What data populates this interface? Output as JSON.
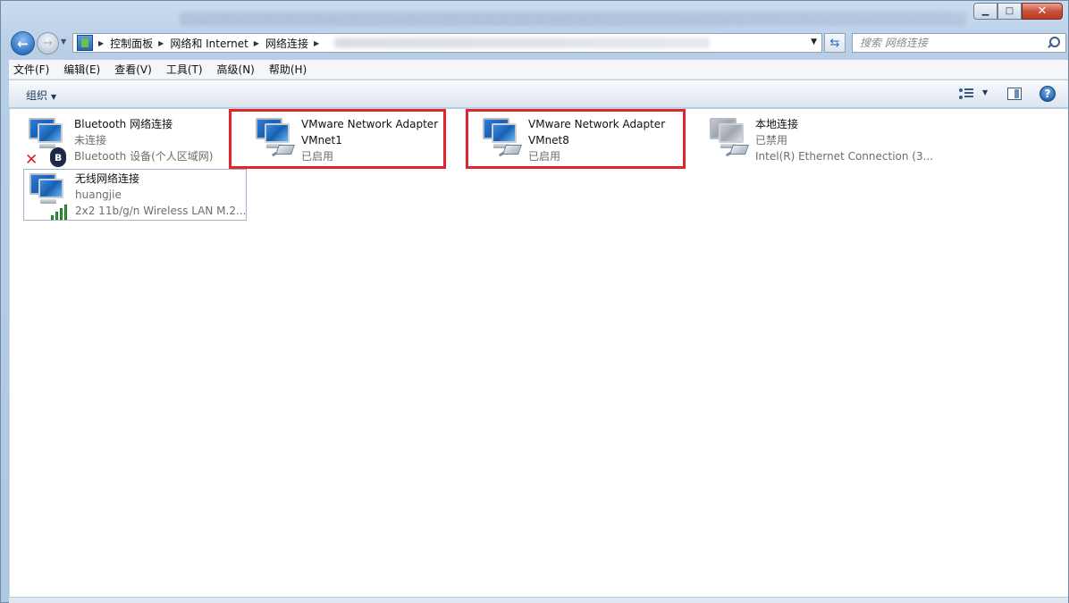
{
  "window": {
    "controls": {
      "minimize": "▁",
      "maximize": "□",
      "close": "✕"
    }
  },
  "nav": {
    "back_icon": "←",
    "forward_icon": "→",
    "history_icon": "▼",
    "breadcrumbs": [
      "控制面板",
      "网络和 Internet",
      "网络连接"
    ],
    "breadcrumb_sep": "▶",
    "address_dropdown": "▼",
    "refresh_icon": "⇆",
    "search_placeholder": "搜索 网络连接"
  },
  "menu": [
    "文件(F)",
    "编辑(E)",
    "查看(V)",
    "工具(T)",
    "高级(N)",
    "帮助(H)"
  ],
  "toolbar": {
    "organize_label": "组织",
    "organize_dropdown": "▼",
    "view_dropdown": "▼",
    "help_label": "?"
  },
  "connections": [
    {
      "name": "Bluetooth 网络连接",
      "line2": "未连接",
      "line3": "Bluetooth 设备(个人区域网)",
      "status_icon": "disconnected-x-icon",
      "type_icon": "bluetooth-icon",
      "bt_glyph": "ʙ",
      "x_glyph": "✕"
    },
    {
      "name": "VMware Network Adapter",
      "line2": "VMnet1",
      "line3": "已启用"
    },
    {
      "name": "VMware Network Adapter",
      "line2": "VMnet8",
      "line3": "已启用"
    },
    {
      "name": "本地连接",
      "line2": "已禁用",
      "line3": "Intel(R) Ethernet Connection (3..."
    },
    {
      "name": "无线网络连接",
      "line2": "huangjie",
      "line3": "2x2 11b/g/n Wireless LAN M.2..."
    }
  ],
  "highlight_color": "#e0252c"
}
